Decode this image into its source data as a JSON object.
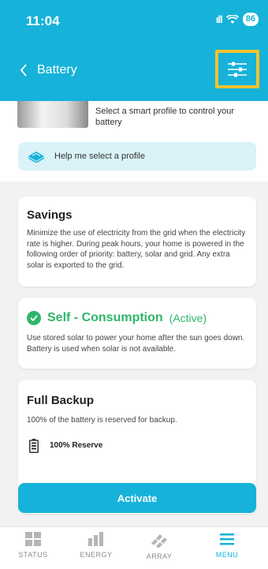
{
  "status_bar": {
    "time": "11:04",
    "battery": "86"
  },
  "header": {
    "title": "Battery"
  },
  "intro": {
    "text": "Select a smart profile to control your battery"
  },
  "help": {
    "label": "Help me select a profile"
  },
  "profiles": {
    "savings": {
      "title": "Savings",
      "description": "Minimize the use of electricity from the grid when the electricity rate is higher. During peak hours, your home is powered in the following order of priority: battery, solar and grid. Any extra solar is exported to the grid."
    },
    "self_consumption": {
      "title": "Self - Consumption",
      "status": "(Active)",
      "description": "Use stored solar to power your home after the sun goes down. Battery is used when solar is not available."
    },
    "full_backup": {
      "title": "Full Backup",
      "description": "100% of the battery is reserved for backup.",
      "reserve": "100% Reserve"
    }
  },
  "activate_label": "Activate",
  "tabs": [
    {
      "label": "STATUS",
      "icon": "status-grid-icon"
    },
    {
      "label": "ENERGY",
      "icon": "energy-bars-icon"
    },
    {
      "label": "ARRAY",
      "icon": "array-panels-icon"
    },
    {
      "label": "MENU",
      "icon": "menu-icon"
    }
  ],
  "colors": {
    "brand": "#16b2d9",
    "active_green": "#2fb56a",
    "highlight": "#f2c230"
  }
}
